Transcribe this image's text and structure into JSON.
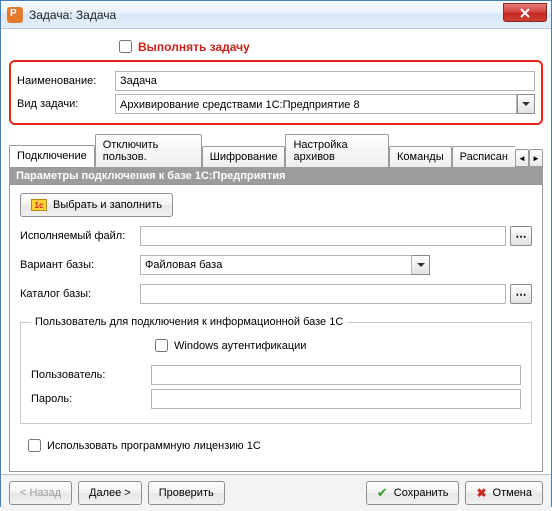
{
  "window": {
    "title": "Задача: Задача"
  },
  "top": {
    "exec_label": "Выполнять задачу",
    "name_label": "Наименование:",
    "name_value": "Задача",
    "type_label": "Вид задачи:",
    "type_value": "Архивирование средствами 1С:Предприятие 8"
  },
  "tabs": {
    "items": [
      {
        "label": "Подключение"
      },
      {
        "label": "Отключить пользов."
      },
      {
        "label": "Шифрование"
      },
      {
        "label": "Настройка архивов"
      },
      {
        "label": "Команды"
      },
      {
        "label": "Расписан"
      }
    ]
  },
  "connection": {
    "section_title": "Параметры подключения к базе 1С:Предприятия",
    "select_fill_btn": "Выбрать и заполнить",
    "exe_label": "Исполняемый файл:",
    "exe_value": "",
    "variant_label": "Вариант базы:",
    "variant_value": "Файловая база",
    "catalog_label": "Каталог базы:",
    "catalog_value": "",
    "auth_legend": "Пользователь для подключения к информационной базе 1С",
    "win_auth_label": "Windows аутентификации",
    "user_label": "Пользователь:",
    "user_value": "",
    "pass_label": "Пароль:",
    "pass_value": "",
    "prog_license_label": "Использовать программную лицензию 1С"
  },
  "buttons": {
    "back": "< Назад",
    "next": "Далее >",
    "check": "Проверить",
    "save": "Сохранить",
    "cancel": "Отмена"
  }
}
